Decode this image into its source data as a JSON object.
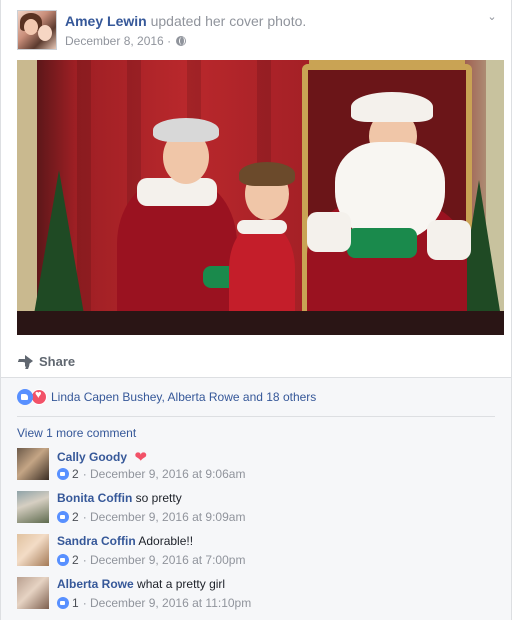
{
  "post": {
    "author": "Amey Lewin",
    "action": "updated her cover photo.",
    "date": "December 8, 2016",
    "separator": "·"
  },
  "actions": {
    "share_label": "Share"
  },
  "reactions": {
    "summary": "Linda Capen Bushey, Alberta Rowe and 18 others"
  },
  "comments_section": {
    "view_more": "View 1 more comment",
    "comments": [
      {
        "name": "Cally Goody",
        "text": "",
        "likes": "2",
        "time": "· December 9, 2016 at 9:06am",
        "emoji": "heart"
      },
      {
        "name": "Bonita Coffin",
        "text": "so pretty",
        "likes": "2",
        "time": "· December 9, 2016 at 9:09am"
      },
      {
        "name": "Sandra Coffin",
        "text": "Adorable!!",
        "likes": "2",
        "time": "· December 9, 2016 at 7:00pm"
      },
      {
        "name": "Alberta Rowe",
        "text": "what a pretty girl",
        "likes": "1",
        "time": "· December 9, 2016 at 11:10pm"
      }
    ]
  },
  "colors": {
    "link": "#365899",
    "meta": "#90949c",
    "like_blue": "#5890ff",
    "love_red": "#f25268"
  }
}
